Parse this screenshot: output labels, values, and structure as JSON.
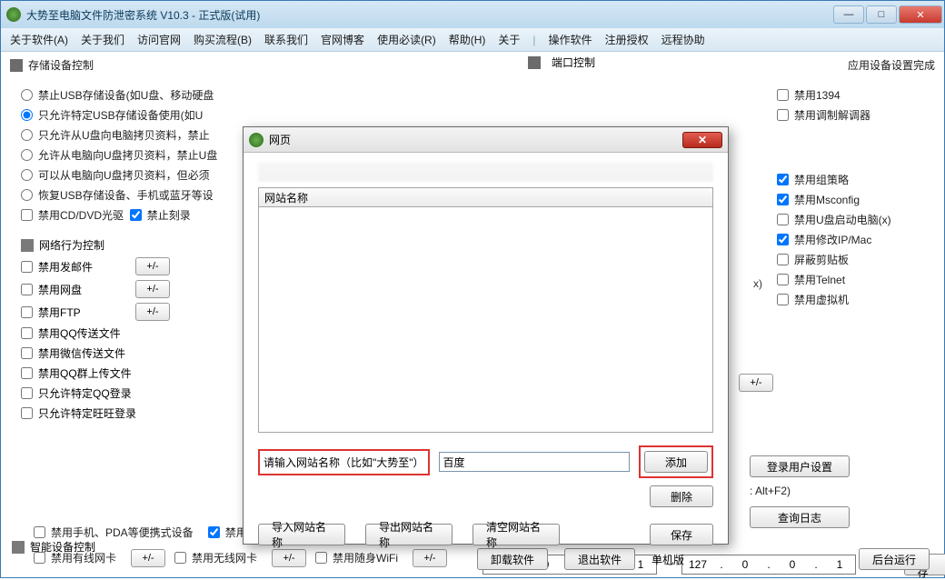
{
  "titlebar": {
    "text": "大势至电脑文件防泄密系统 V10.3 - 正式版(试用)"
  },
  "winbtns": {
    "min": "—",
    "max": "□",
    "close": "✕"
  },
  "menu": {
    "items": [
      "关于软件(A)",
      "关于我们",
      "访问官网",
      "购买流程(B)",
      "联系我们",
      "官网博客",
      "使用必读(R)",
      "帮助(H)",
      "关于"
    ],
    "right": [
      "操作软件",
      "注册授权",
      "远程协助"
    ]
  },
  "sections": {
    "storage": "存储设备控制",
    "port": "端口控制",
    "status_done": "应用设备设置完成",
    "netctrl": "网络行为控制",
    "smart": "智能设备控制"
  },
  "storage_opts": {
    "r1": "禁止USB存储设备(如U盘、移动硬盘",
    "r2": "只允许特定USB存储设备使用(如U",
    "r3": "只允许从U盘向电脑拷贝资料，禁止",
    "r4": "允许从电脑向U盘拷贝资料，禁止U盘",
    "r5": "可以从电脑向U盘拷贝资料，但必须",
    "r6": "恢复USB存储设备、手机或蓝牙等设",
    "cb_cd": "禁用CD/DVD光驱",
    "cb_burn": "禁止刻录"
  },
  "net_items": {
    "mail": "禁用发邮件",
    "pan": "禁用网盘",
    "ftp": "禁用FTP",
    "qqfile": "禁用QQ传送文件",
    "wxfile": "禁用微信传送文件",
    "qqgroup": "禁用QQ群上传文件",
    "qqlimit": "只允许特定QQ登录",
    "wwlimit": "只允许特定旺旺登录"
  },
  "pm_label": "+/-",
  "right_items": {
    "r1394": "禁用1394",
    "modem": "禁用调制解调器",
    "gpo": "禁用组策略",
    "msconfig": "禁用Msconfig",
    "ustart": "禁用U盘启动电脑(x)",
    "ipmac": "禁用修改IP/Mac",
    "clip": "屏蔽剪贴板",
    "telnet": "禁用Telnet",
    "vm": "禁用虚拟机"
  },
  "buttons": {
    "login_set": "登录用户设置",
    "hotkey": ": Alt+F2)",
    "querylog": "查询日志",
    "save": "保存",
    "uninstall": "卸载软件",
    "exit": "退出软件",
    "standalone": "单机版",
    "bgrun": "后台运行"
  },
  "smart": {
    "pda": "禁用手机、PDA等便携式设备",
    "assist": "禁用手机助手",
    "wired": "禁用有线网卡",
    "wireless": "禁用无线网卡",
    "wifi": "禁用随身WiFi"
  },
  "ip": {
    "a": "127",
    "b": "0",
    "c": "0",
    "d": "1"
  },
  "modal": {
    "title": "网页",
    "col": "网站名称",
    "prompt": "请输入网站名称（比如\"大势至\"）",
    "value": "百度",
    "add": "添加",
    "del": "删除",
    "import": "导入网站名称",
    "export": "导出网站名称",
    "clear": "清空网站名称",
    "save": "保存"
  },
  "x_hint": "x)"
}
